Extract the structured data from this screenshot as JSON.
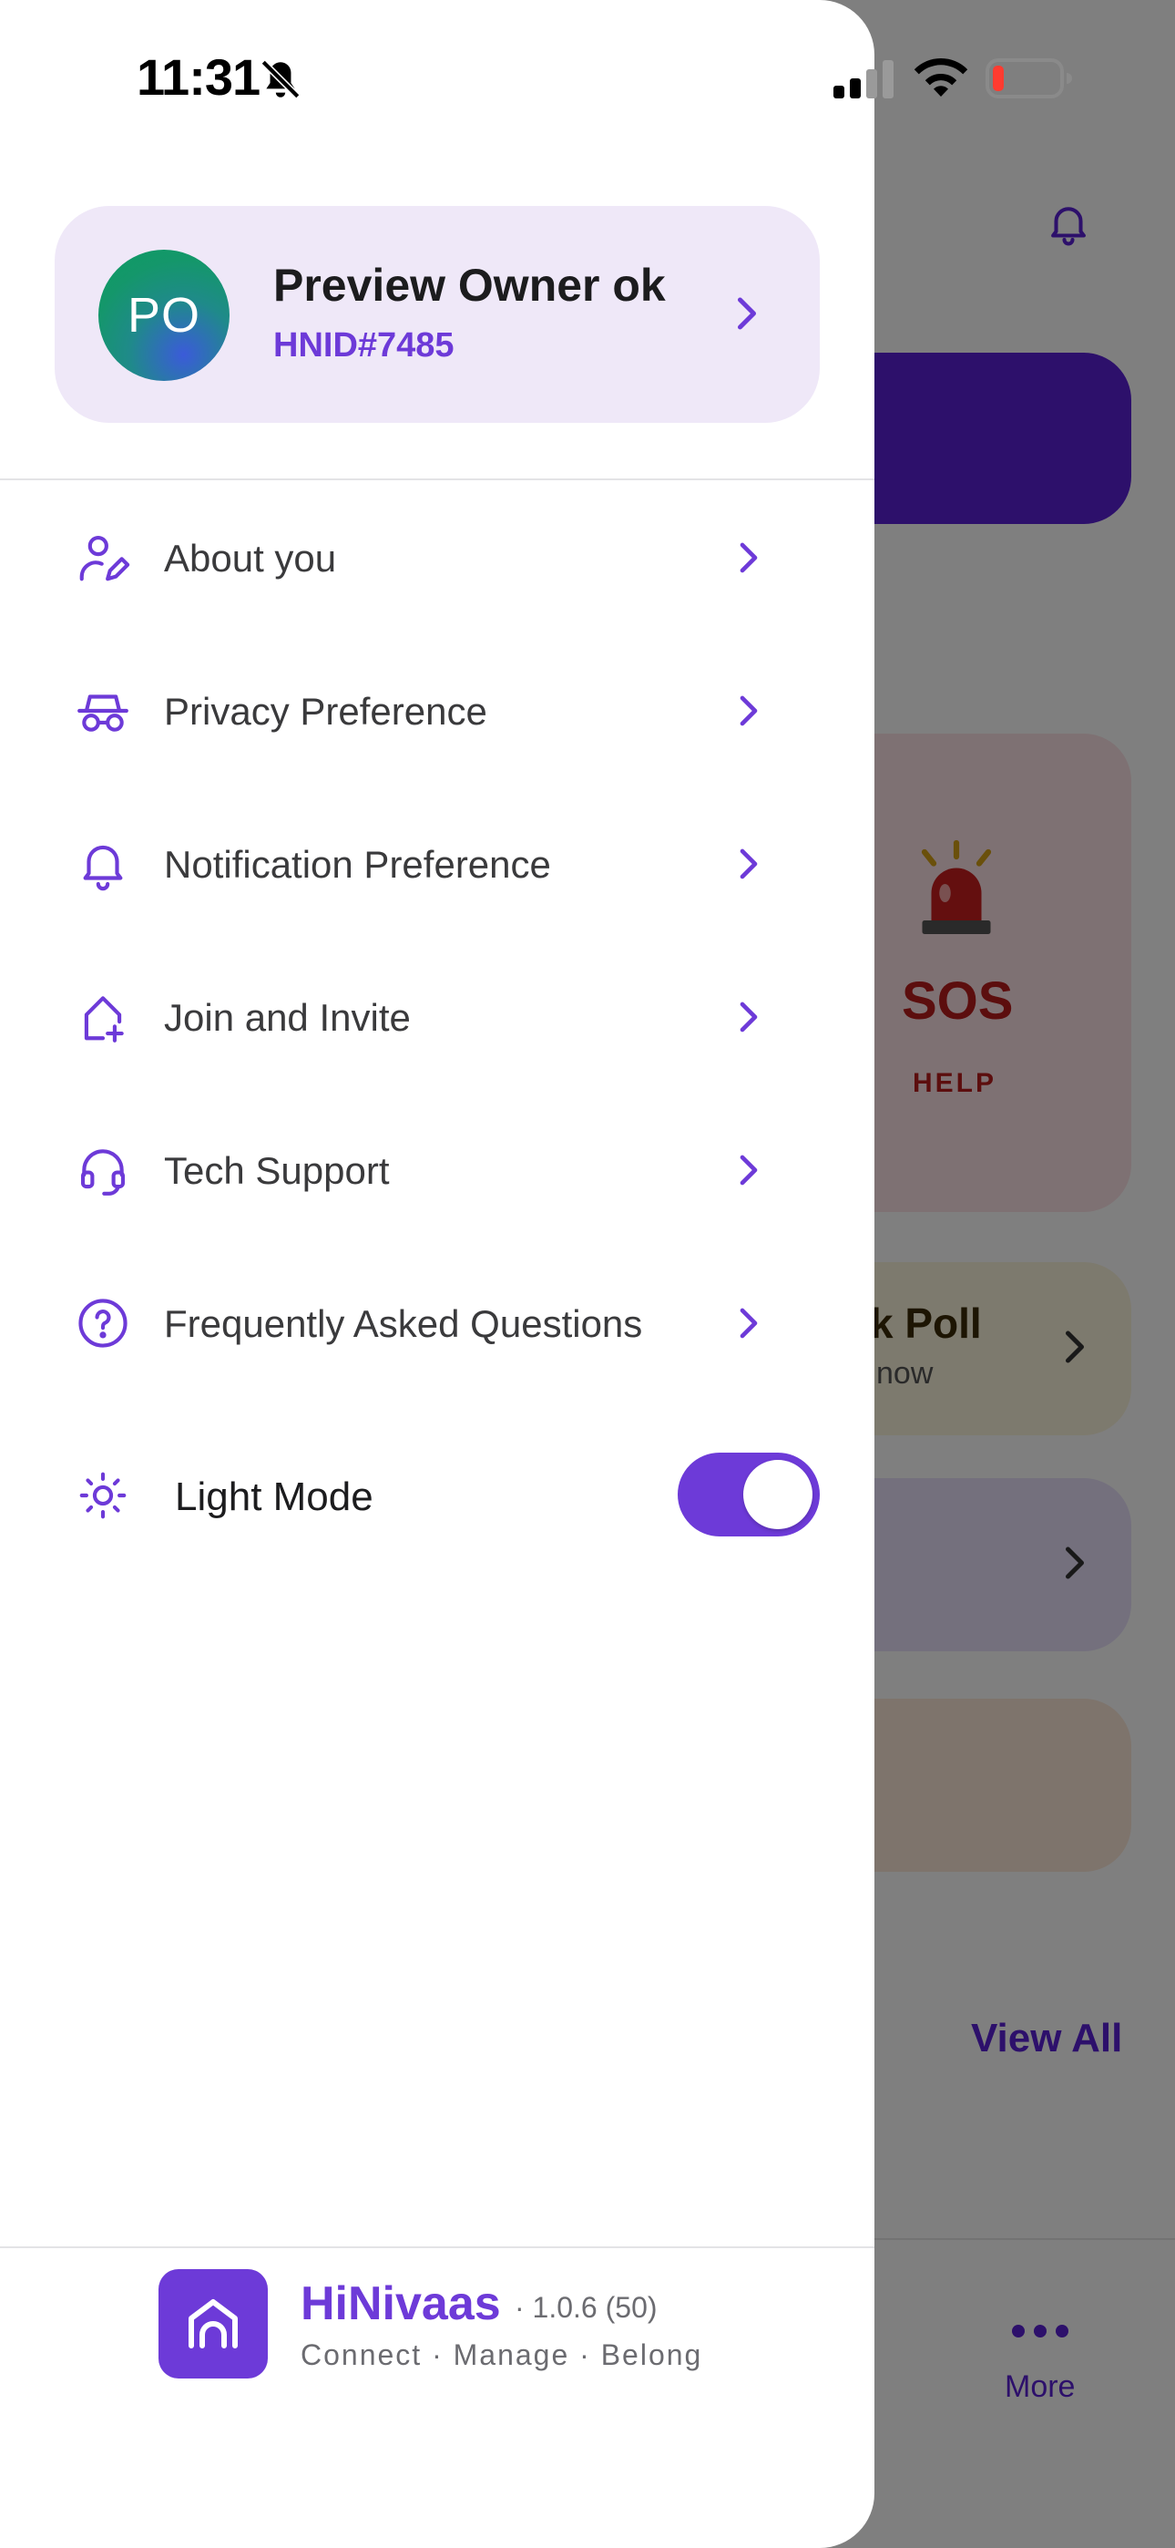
{
  "status_bar": {
    "time": "11:31",
    "mute_icon": "bell-slash-icon",
    "signal_icon": "cellular-signal-icon",
    "wifi_icon": "wifi-icon",
    "battery_icon": "battery-low-icon"
  },
  "profile": {
    "initials": "PO",
    "name": "Preview Owner ok",
    "hnid": "HNID#7485"
  },
  "menu": {
    "items": [
      {
        "label": "About you",
        "icon": "user-edit-icon"
      },
      {
        "label": "Privacy Preference",
        "icon": "incognito-icon"
      },
      {
        "label": "Notification Preference",
        "icon": "bell-icon"
      },
      {
        "label": "Join and Invite",
        "icon": "home-plus-icon"
      },
      {
        "label": "Tech Support",
        "icon": "headset-icon"
      },
      {
        "label": "Frequently Asked Questions",
        "icon": "question-circle-icon"
      }
    ]
  },
  "light_mode": {
    "label": "Light Mode",
    "icon": "sun-icon",
    "enabled": true
  },
  "footer": {
    "app_name": "HiNivaas",
    "version": "· 1.0.6 (50)",
    "tagline": "Connect · Manage · Belong"
  },
  "background": {
    "sos_title": "SOS",
    "sos_subtitle": "HELP",
    "poll_title": "k Poll",
    "poll_subtitle": "now",
    "view_all": "View All",
    "more_label": "More"
  },
  "colors": {
    "accent": "#6D3AD8",
    "profile_card_bg": "#EFE8F8",
    "sos_red": "#B91C1C"
  }
}
